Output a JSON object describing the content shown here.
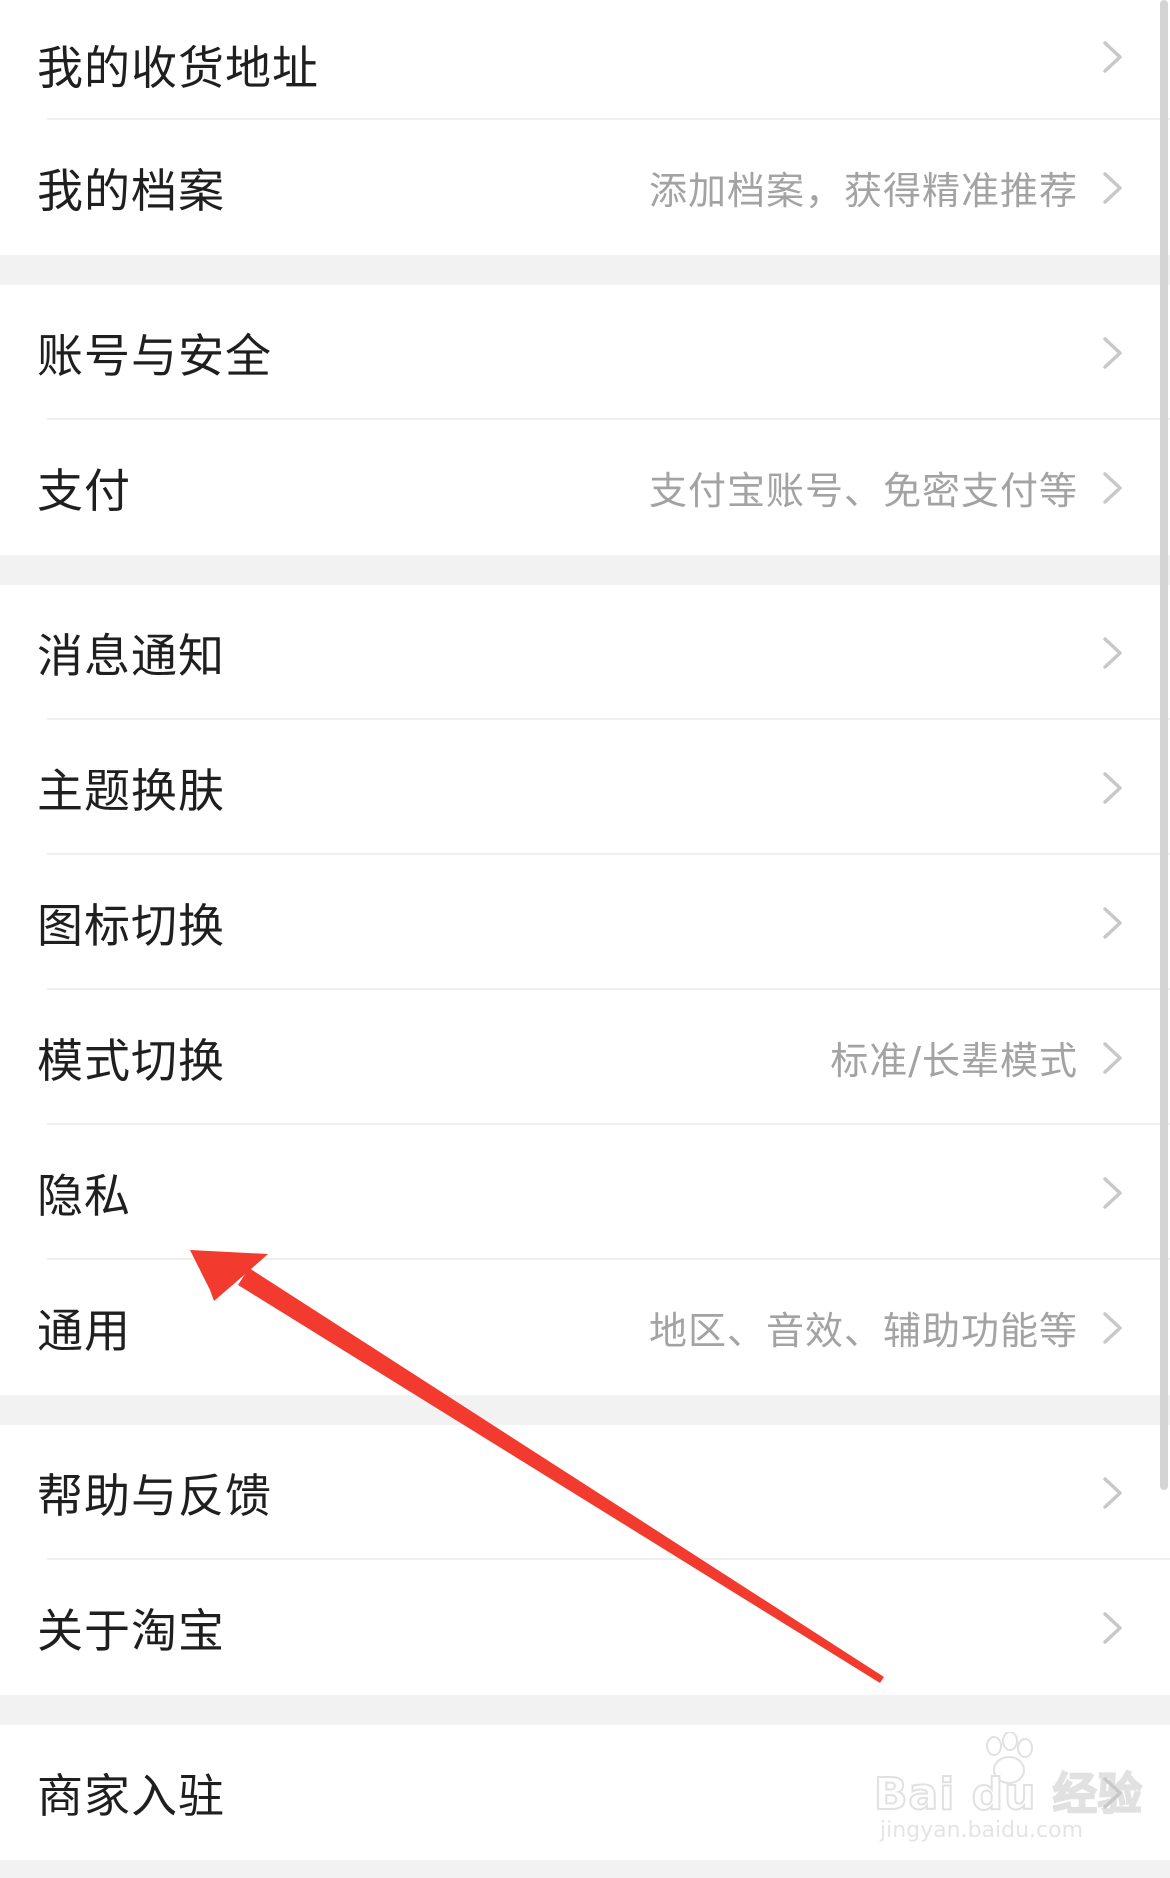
{
  "settings": {
    "groups": [
      {
        "items": [
          {
            "label": "我的收货地址",
            "hint": ""
          },
          {
            "label": "我的档案",
            "hint": "添加档案，获得精准推荐"
          }
        ]
      },
      {
        "items": [
          {
            "label": "账号与安全",
            "hint": ""
          },
          {
            "label": "支付",
            "hint": "支付宝账号、免密支付等"
          }
        ]
      },
      {
        "items": [
          {
            "label": "消息通知",
            "hint": ""
          },
          {
            "label": "主题换肤",
            "hint": ""
          },
          {
            "label": "图标切换",
            "hint": ""
          },
          {
            "label": "模式切换",
            "hint": "标准/长辈模式"
          },
          {
            "label": "隐私",
            "hint": ""
          },
          {
            "label": "通用",
            "hint": "地区、音效、辅助功能等"
          }
        ]
      },
      {
        "items": [
          {
            "label": "帮助与反馈",
            "hint": ""
          },
          {
            "label": "关于淘宝",
            "hint": ""
          }
        ]
      },
      {
        "items": [
          {
            "label": "商家入驻",
            "hint": ""
          }
        ]
      }
    ]
  },
  "annotation": {
    "color": "#f23a2f",
    "points_to": "隐私"
  },
  "watermark": {
    "text": "Bai du 经验",
    "url": "jingyan.baidu.com"
  },
  "icons": {
    "chevron": "chevron-right-icon",
    "arrow": "red-annotation-arrow"
  },
  "colors": {
    "background": "#f2f2f2",
    "card": "#ffffff",
    "label": "#1f1f1f",
    "hint": "#a3a3a3",
    "chevron": "#c8c8c8"
  }
}
